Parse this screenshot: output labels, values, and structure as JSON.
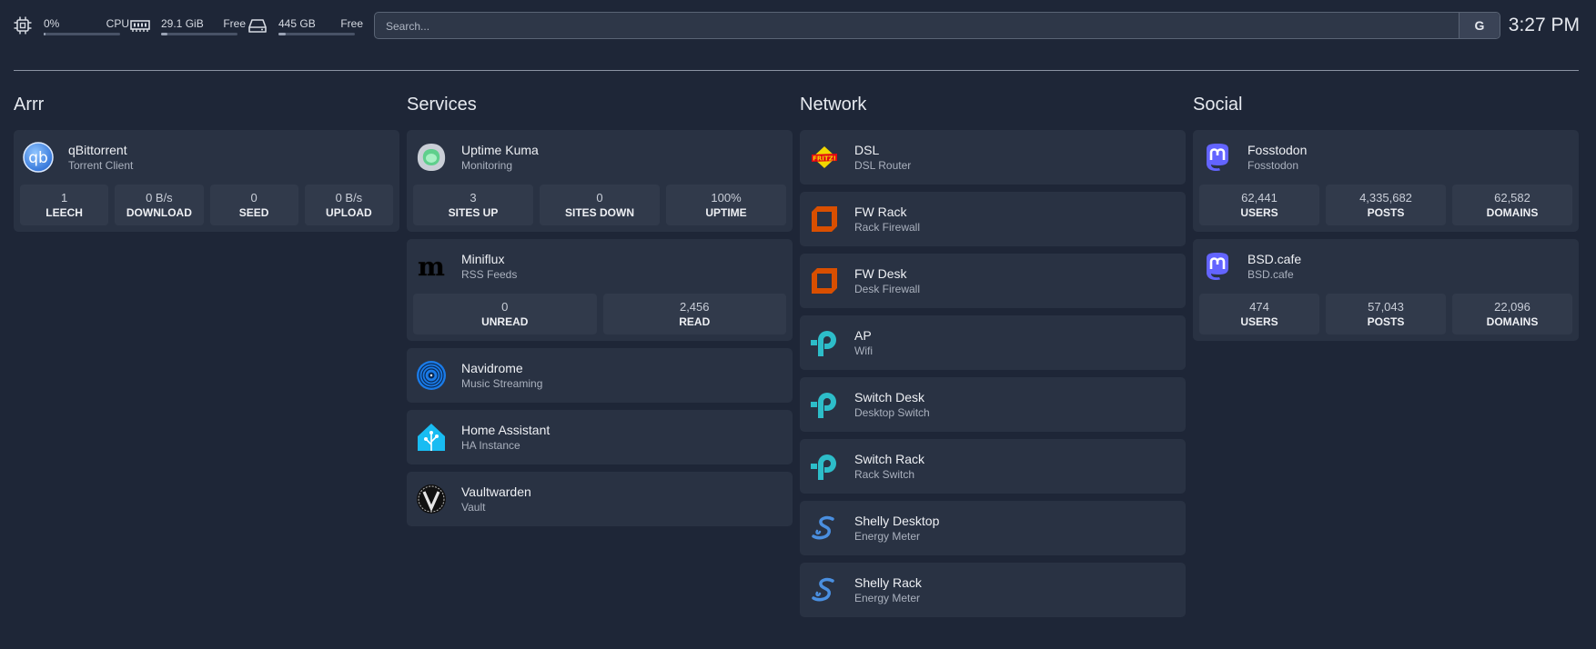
{
  "resources": {
    "cpu": {
      "value": "0%",
      "label": "CPU",
      "level": 0.02
    },
    "memory": {
      "value": "29.1 GiB",
      "label": "Free",
      "level": 0.08
    },
    "disk": {
      "value": "445 GB",
      "label": "Free",
      "level": 0.1
    }
  },
  "search": {
    "placeholder": "Search...",
    "button_label": "G"
  },
  "clock": "3:27 PM",
  "columns": {
    "arrr": {
      "title": "Arrr",
      "services": [
        {
          "name": "qBittorrent",
          "desc": "Torrent Client",
          "icon": "qbittorrent-icon",
          "stats": [
            {
              "value": "1",
              "label": "LEECH"
            },
            {
              "value": "0 B/s",
              "label": "DOWNLOAD"
            },
            {
              "value": "0",
              "label": "SEED"
            },
            {
              "value": "0 B/s",
              "label": "UPLOAD"
            }
          ]
        }
      ]
    },
    "services": {
      "title": "Services",
      "services": [
        {
          "name": "Uptime Kuma",
          "desc": "Monitoring",
          "icon": "uptime-kuma-icon",
          "stats": [
            {
              "value": "3",
              "label": "SITES UP"
            },
            {
              "value": "0",
              "label": "SITES DOWN"
            },
            {
              "value": "100%",
              "label": "UPTIME"
            }
          ]
        },
        {
          "name": "Miniflux",
          "desc": "RSS Feeds",
          "icon": "miniflux-icon",
          "stats": [
            {
              "value": "0",
              "label": "UNREAD"
            },
            {
              "value": "2,456",
              "label": "READ"
            }
          ]
        },
        {
          "name": "Navidrome",
          "desc": "Music Streaming",
          "icon": "navidrome-icon"
        },
        {
          "name": "Home Assistant",
          "desc": "HA Instance",
          "icon": "home-assistant-icon"
        },
        {
          "name": "Vaultwarden",
          "desc": "Vault",
          "icon": "vaultwarden-icon"
        }
      ]
    },
    "network": {
      "title": "Network",
      "services": [
        {
          "name": "DSL",
          "desc": "DSL Router",
          "icon": "fritzbox-icon"
        },
        {
          "name": "FW Rack",
          "desc": "Rack Firewall",
          "icon": "opnsense-icon"
        },
        {
          "name": "FW Desk",
          "desc": "Desk Firewall",
          "icon": "opnsense-icon"
        },
        {
          "name": "AP",
          "desc": "Wifi",
          "icon": "tplink-icon"
        },
        {
          "name": "Switch Desk",
          "desc": "Desktop Switch",
          "icon": "tplink-icon"
        },
        {
          "name": "Switch Rack",
          "desc": "Rack Switch",
          "icon": "tplink-icon"
        },
        {
          "name": "Shelly Desktop",
          "desc": "Energy Meter",
          "icon": "shelly-icon"
        },
        {
          "name": "Shelly Rack",
          "desc": "Energy Meter",
          "icon": "shelly-icon"
        }
      ]
    },
    "social": {
      "title": "Social",
      "services": [
        {
          "name": "Fosstodon",
          "desc": "Fosstodon",
          "icon": "mastodon-icon",
          "stats": [
            {
              "value": "62,441",
              "label": "USERS"
            },
            {
              "value": "4,335,682",
              "label": "POSTS"
            },
            {
              "value": "62,582",
              "label": "DOMAINS"
            }
          ]
        },
        {
          "name": "BSD.cafe",
          "desc": "BSD.cafe",
          "icon": "mastodon-icon",
          "stats": [
            {
              "value": "474",
              "label": "USERS"
            },
            {
              "value": "57,043",
              "label": "POSTS"
            },
            {
              "value": "22,096",
              "label": "DOMAINS"
            }
          ]
        }
      ]
    }
  }
}
